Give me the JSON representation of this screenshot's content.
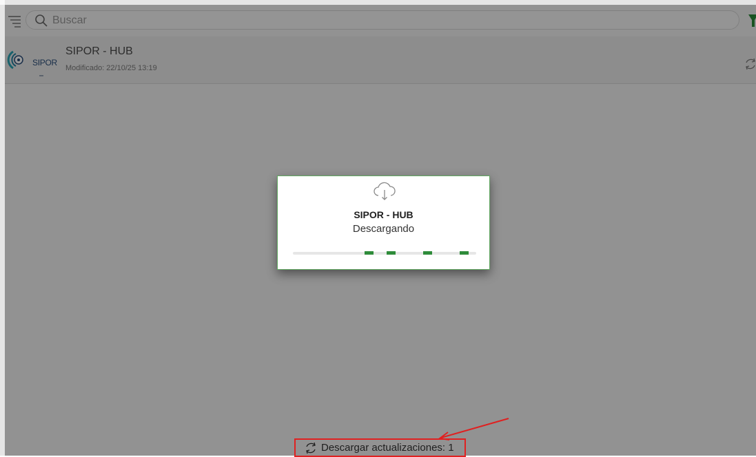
{
  "search": {
    "placeholder": "Buscar"
  },
  "list": {
    "items": [
      {
        "logo_text": "SIPOR",
        "title": "SIPOR - HUB",
        "modified": "Modificado: 22/10/25 13:19"
      }
    ]
  },
  "dialog": {
    "title": "SIPOR - HUB",
    "status": "Descargando"
  },
  "footer": {
    "updates_label": "Descargar actualizaciones: 1"
  },
  "colors": {
    "accent_green": "#2e8b3a",
    "annotation_red": "#e02020"
  },
  "icons": [
    "menu-icon",
    "search-icon",
    "filter-icon",
    "sync-icon",
    "cloud-download-icon"
  ]
}
